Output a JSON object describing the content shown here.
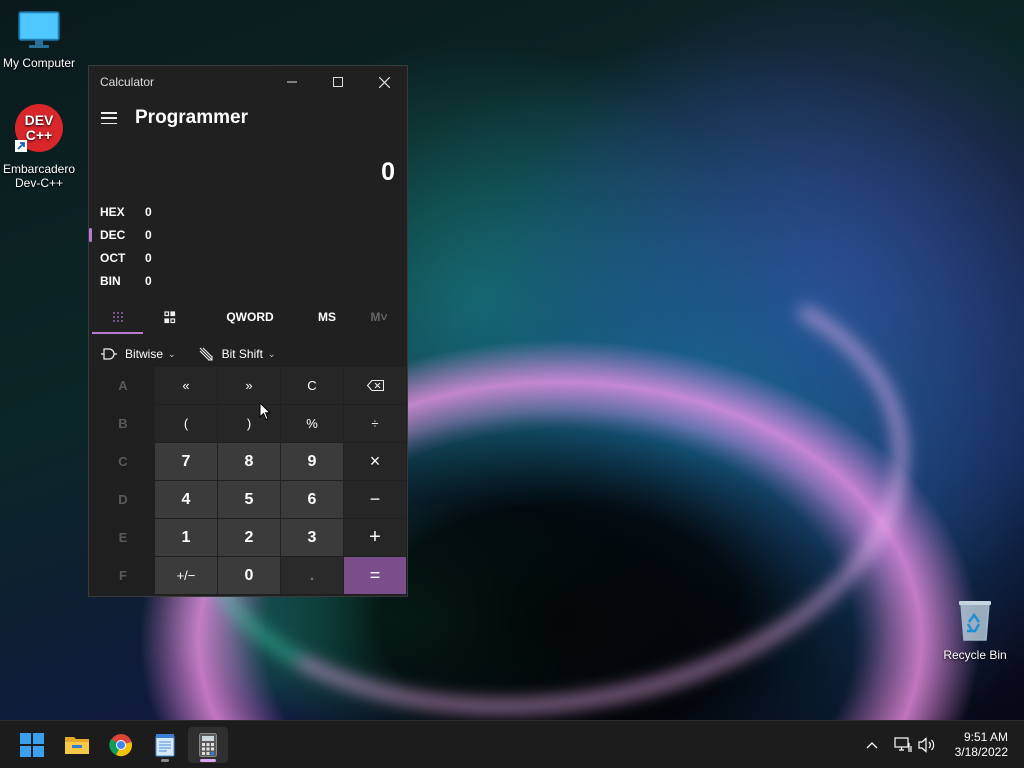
{
  "desktop": {
    "icons": [
      {
        "label": "My Computer"
      },
      {
        "label": "Embarcadero Dev-C++",
        "logo_text": "DEV C++"
      },
      {
        "label": "Recycle Bin"
      }
    ]
  },
  "calculator": {
    "window_title": "Calculator",
    "mode": "Programmer",
    "display_value": "0",
    "radix": [
      {
        "name": "HEX",
        "value": "0"
      },
      {
        "name": "DEC",
        "value": "0",
        "selected": true
      },
      {
        "name": "OCT",
        "value": "0"
      },
      {
        "name": "BIN",
        "value": "0"
      }
    ],
    "tabs": {
      "keypad_icon": "full-keypad-icon",
      "bit_toggle_icon": "bit-toggle-keypad-icon",
      "word_size": "QWORD",
      "memory_store": "MS",
      "memory_recall": "M˅"
    },
    "ops": {
      "bitwise": "Bitwise",
      "bitshift": "Bit Shift"
    },
    "keys": [
      [
        "A",
        "«",
        "»",
        "C",
        "⌫"
      ],
      [
        "B",
        "(",
        ")",
        "%",
        "÷"
      ],
      [
        "C",
        "7",
        "8",
        "9",
        "×"
      ],
      [
        "D",
        "4",
        "5",
        "6",
        "−"
      ],
      [
        "E",
        "1",
        "2",
        "3",
        "+"
      ],
      [
        "F",
        "+/−",
        "0",
        ".",
        "="
      ]
    ],
    "accent_color": "#b57cd1"
  },
  "taskbar": {
    "clock_time": "9:51 AM",
    "clock_date": "3/18/2022"
  }
}
